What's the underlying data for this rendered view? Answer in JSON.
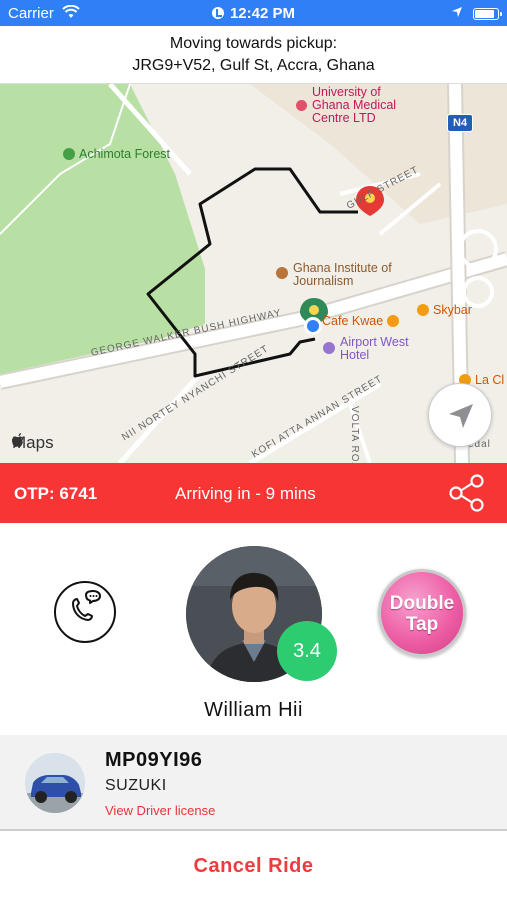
{
  "status_bar": {
    "carrier": "Carrier",
    "time": "12:42 PM"
  },
  "pickup": {
    "heading": "Moving towards pickup:",
    "address": "JRG9+V52, Gulf St, Accra, Ghana"
  },
  "map": {
    "brand": "Maps",
    "highway_badge": "N4",
    "pois": {
      "university": "University of Ghana Medical Centre LTD",
      "forest": "Achimota Forest",
      "journalism": "Ghana Institute of Journalism",
      "cafe": "Cafe Kwae",
      "skybar": "Skybar",
      "hotel": "Airport West Hotel",
      "la": "La Cl"
    },
    "streets": {
      "highway": "GEORGE WALKER BUSH HIGHWAY",
      "nyanchi": "NII NORTEY NYANCHI STREET",
      "kofi": "KOFI ATTA ANNAN STREET",
      "volta": "VOLTA ROAD",
      "gulf": "GULF STREET",
      "edal": "edal"
    }
  },
  "otp_bar": {
    "otp": "OTP: 6741",
    "eta": "Arriving in - 9 mins"
  },
  "driver": {
    "name": "William Hii",
    "rating": "3.4",
    "double_tap": [
      "Double",
      "Tap"
    ]
  },
  "vehicle": {
    "plate": "MP09YI96",
    "make": "SUZUKI",
    "license_link": "View Driver license"
  },
  "actions": {
    "cancel": "Cancel Ride"
  },
  "colors": {
    "status_bar": "#2f7ff6",
    "otp_bar": "#f73535",
    "rating": "#2ecc71",
    "cancel": "#ee3b3b",
    "route": "#111111"
  }
}
